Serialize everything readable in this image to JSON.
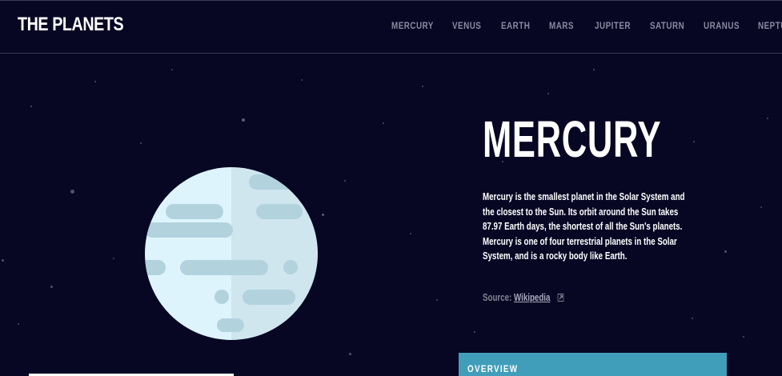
{
  "header": {
    "logo": "THE PLANETS",
    "nav": [
      "MERCURY",
      "VENUS",
      "EARTH",
      "MARS",
      "JUPITER",
      "SATURN",
      "URANUS",
      "NEPTUNE"
    ]
  },
  "planet": {
    "name": "MERCURY",
    "description": "Mercury is the smallest planet in the Solar System and the closest to the Sun. Its orbit around the Sun takes 87.97 Earth days, the shortest of all the Sun's planets. Mercury is one of four terrestrial planets in the Solar System, and is a rocky body like Earth.",
    "source_label": "Source: ",
    "source_link": "Wikipedia",
    "illustration_icon": "mercury-planet-illustration"
  },
  "tabs": {
    "overview": "OVERVIEW"
  },
  "colors": {
    "background": "#070724",
    "accent": "#419ebb",
    "nav_text": "#8a8aa0"
  }
}
